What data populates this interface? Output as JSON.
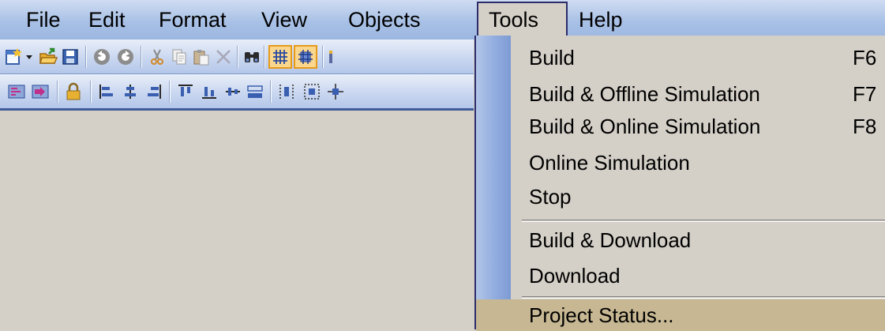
{
  "menubar": {
    "items": [
      {
        "label": "File"
      },
      {
        "label": "Edit"
      },
      {
        "label": "Format"
      },
      {
        "label": "View"
      },
      {
        "label": "Objects"
      },
      {
        "label": "Tools"
      },
      {
        "label": "Help"
      }
    ],
    "active": "Tools"
  },
  "toolbar_1": {
    "icons": [
      "new-screen-icon",
      "dropdown-arrow-icon",
      "open-folder-icon",
      "save-icon",
      "undo-icon",
      "redo-icon",
      "cut-icon",
      "copy-icon",
      "paste-icon",
      "delete-icon",
      "find-icon",
      "grid-icon",
      "snap-to-grid-icon",
      "more-icon"
    ],
    "pressed": [
      "grid-icon",
      "snap-to-grid-icon"
    ]
  },
  "toolbar_2": {
    "icons": [
      "tab-order-icon",
      "tab-order-2-icon",
      "lock-icon",
      "align-left-icon",
      "align-center-icon",
      "align-right-icon",
      "align-top-icon",
      "align-middle-icon",
      "align-bottom-icon",
      "same-size-icon",
      "space-evenly-icon",
      "center-in-screen-icon",
      "center-both-icon"
    ]
  },
  "tools_menu": {
    "items": [
      {
        "label": "Build",
        "shortcut": "F6"
      },
      {
        "label": "Build & Offline Simulation",
        "shortcut": "F7"
      },
      {
        "label": "Build & Online Simulation",
        "shortcut": "F8"
      },
      {
        "label": "Online Simulation",
        "shortcut": ""
      },
      {
        "label": "Stop",
        "shortcut": ""
      },
      {
        "label": "Build & Download",
        "shortcut": ""
      },
      {
        "label": "Download",
        "shortcut": ""
      },
      {
        "label": "Project Status...",
        "shortcut": ""
      }
    ],
    "highlighted": "Project Status..."
  },
  "colors": {
    "menubar": "#a9c1e6",
    "dropdown_bg": "#d4d0c8",
    "highlight": "#c7b893",
    "strip": "#93aee0",
    "workspace": "#d4d0c8"
  }
}
